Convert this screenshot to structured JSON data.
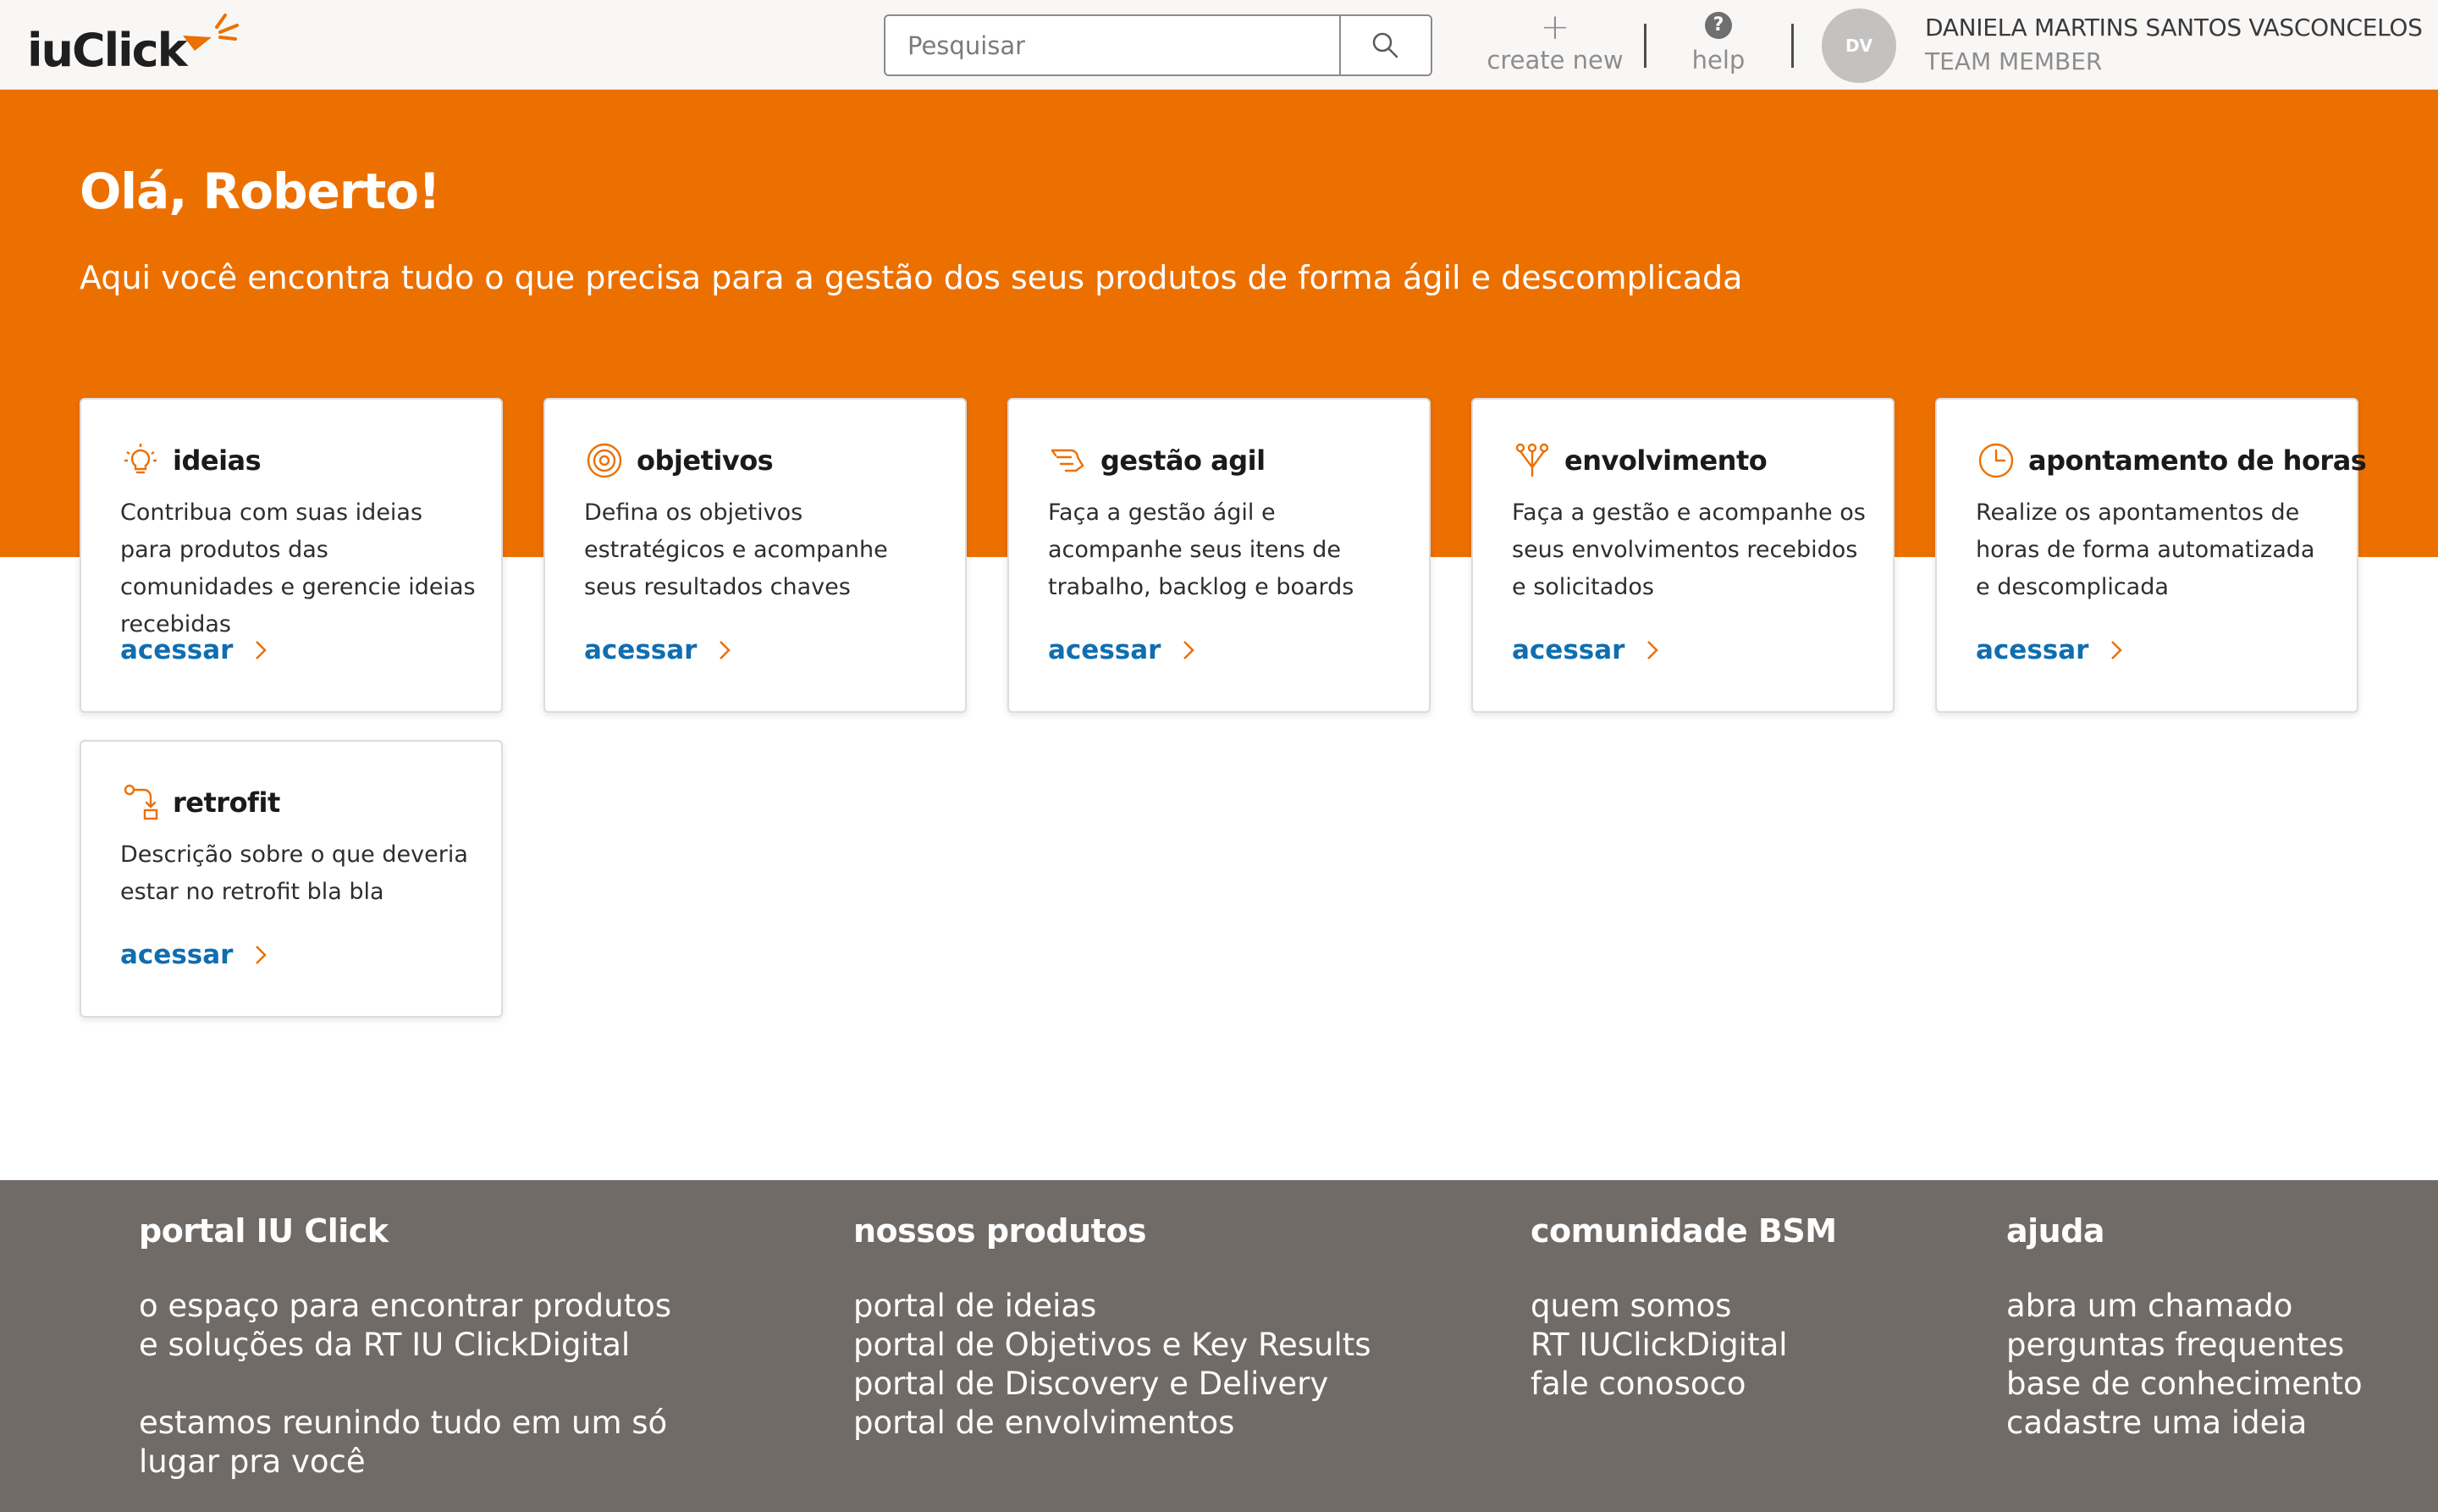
{
  "header": {
    "logo_text": "iuClick",
    "search": {
      "placeholder": "Pesquisar",
      "value": ""
    },
    "create_new_label": "create new",
    "help_label": "help",
    "help_glyph": "?",
    "user": {
      "initials": "DV",
      "name": "DANIELA MARTINS SANTOS VASCONCELOS",
      "role": "TEAM MEMBER"
    }
  },
  "hero": {
    "title": "Olá, Roberto!",
    "subtitle": "Aqui você encontra tudo o que precisa para a gestão dos seus produtos de forma ágil e descomplicada"
  },
  "cards": [
    {
      "icon": "lightbulb-icon",
      "title": "ideias",
      "description": "Contribua com suas ideias para produtos das comunidades e gerencie ideias recebidas",
      "link": "acessar"
    },
    {
      "icon": "target-icon",
      "title": "objetivos",
      "description": "Defina os objetivos estratégicos e acompanhe seus resultados chaves",
      "link": "acessar"
    },
    {
      "icon": "agile-icon",
      "title": "gestão agil",
      "description": "Faça a gestão ágil e acompanhe seus itens de trabalho, backlog e boards",
      "link": "acessar"
    },
    {
      "icon": "branch-icon",
      "title": "envolvimento",
      "description": "Faça a gestão e acompanhe os seus envolvimentos recebidos e solicitados",
      "link": "acessar"
    },
    {
      "icon": "clock-icon",
      "title": "apontamento de horas",
      "description": "Realize os apontamentos de horas de forma automatizada e descomplicada",
      "link": "acessar"
    },
    {
      "icon": "retrofit-icon",
      "title": "retrofit",
      "description": "Descrição sobre o que deveria estar no retrofit bla bla",
      "link": "acessar"
    }
  ],
  "footer": {
    "col1": {
      "title": "portal IU Click",
      "lines": [
        "o espaço para encontrar produtos",
        "e soluções da RT IU ClickDigital",
        "estamos reunindo tudo em um só",
        "lugar pra você"
      ]
    },
    "col2": {
      "title": "nossos produtos",
      "links": [
        "portal de ideias",
        "portal de Objetivos e Key Results",
        "portal de Discovery e Delivery",
        "portal de envolvimentos"
      ]
    },
    "col3": {
      "title": "comunidade BSM",
      "links": [
        "quem somos",
        "RT IUClickDigital",
        "fale conosoco"
      ]
    },
    "col4": {
      "title": "ajuda",
      "links": [
        "abra um chamado",
        "perguntas frequentes",
        "base de conhecimento",
        "cadastre uma ideia"
      ]
    }
  },
  "colors": {
    "accent_orange": "#ec7000",
    "link_blue": "#106eb0",
    "footer_bg": "#716b68",
    "header_bg": "#f9f7f6"
  }
}
